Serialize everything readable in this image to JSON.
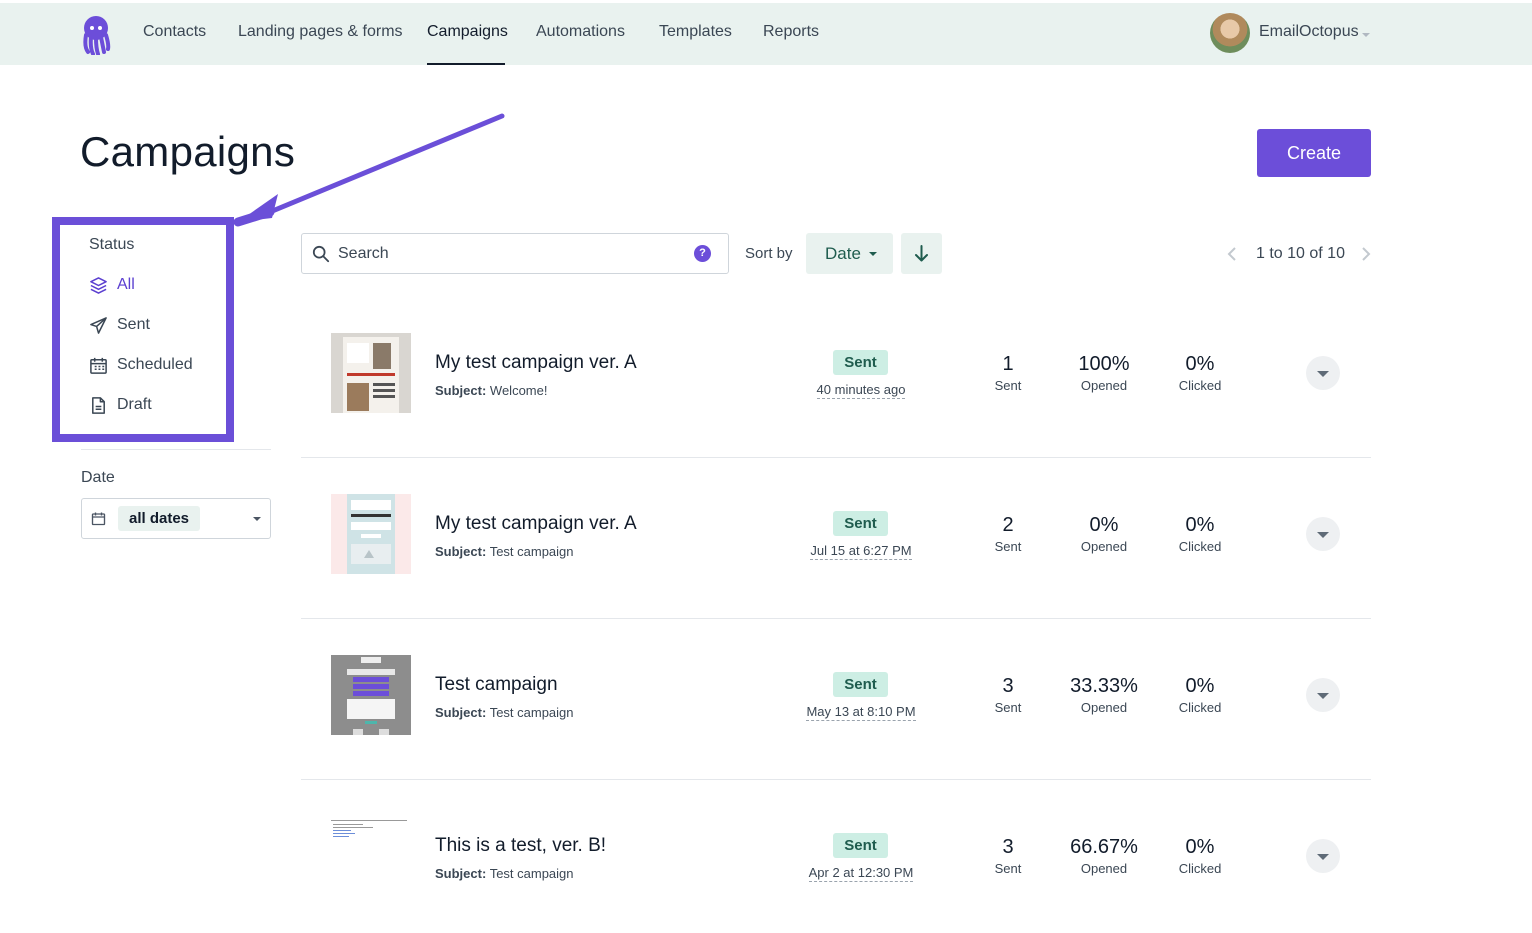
{
  "nav": {
    "items": [
      "Contacts",
      "Landing pages & forms",
      "Campaigns",
      "Automations",
      "Templates",
      "Reports"
    ],
    "account_name": "EmailOctopus"
  },
  "page": {
    "title": "Campaigns",
    "create_label": "Create"
  },
  "sidebar": {
    "status_heading": "Status",
    "status_items": [
      "All",
      "Sent",
      "Scheduled",
      "Draft"
    ],
    "date_heading": "Date",
    "date_value": "all dates"
  },
  "toolbar": {
    "search_placeholder": "Search",
    "help_glyph": "?",
    "sort_label": "Sort by",
    "sort_value": "Date",
    "pagination": "1 to 10 of 10"
  },
  "campaigns": [
    {
      "title": "My test campaign ver. A",
      "subject_label": "Subject:",
      "subject": "Welcome!",
      "status": "Sent",
      "when": "40 minutes ago",
      "sent": "1",
      "sent_label": "Sent",
      "opened": "100%",
      "opened_label": "Opened",
      "clicked": "0%",
      "clicked_label": "Clicked"
    },
    {
      "title": "My test campaign ver. A",
      "subject_label": "Subject:",
      "subject": "Test campaign",
      "status": "Sent",
      "when": "Jul 15 at 6:27 PM",
      "sent": "2",
      "sent_label": "Sent",
      "opened": "0%",
      "opened_label": "Opened",
      "clicked": "0%",
      "clicked_label": "Clicked"
    },
    {
      "title": "Test campaign",
      "subject_label": "Subject:",
      "subject": "Test campaign",
      "status": "Sent",
      "when": "May 13 at 8:10 PM",
      "sent": "3",
      "sent_label": "Sent",
      "opened": "33.33%",
      "opened_label": "Opened",
      "clicked": "0%",
      "clicked_label": "Clicked"
    },
    {
      "title": "This is a test, ver. B!",
      "subject_label": "Subject:",
      "subject": "Test campaign",
      "status": "Sent",
      "when": "Apr 2 at 12:30 PM",
      "sent": "3",
      "sent_label": "Sent",
      "opened": "66.67%",
      "opened_label": "Opened",
      "clicked": "0%",
      "clicked_label": "Clicked"
    }
  ],
  "colors": {
    "brand": "#6c4ed9",
    "annotation": "#6b4fd8",
    "nav_bg": "#e9f2ef",
    "badge_bg": "#cdeee4"
  },
  "icons": [
    "octopus-logo",
    "layers-icon",
    "paper-plane-icon",
    "calendar-icon",
    "document-icon",
    "search-icon",
    "help-icon",
    "arrow-down-icon",
    "chevron-left-icon",
    "chevron-right-icon"
  ]
}
